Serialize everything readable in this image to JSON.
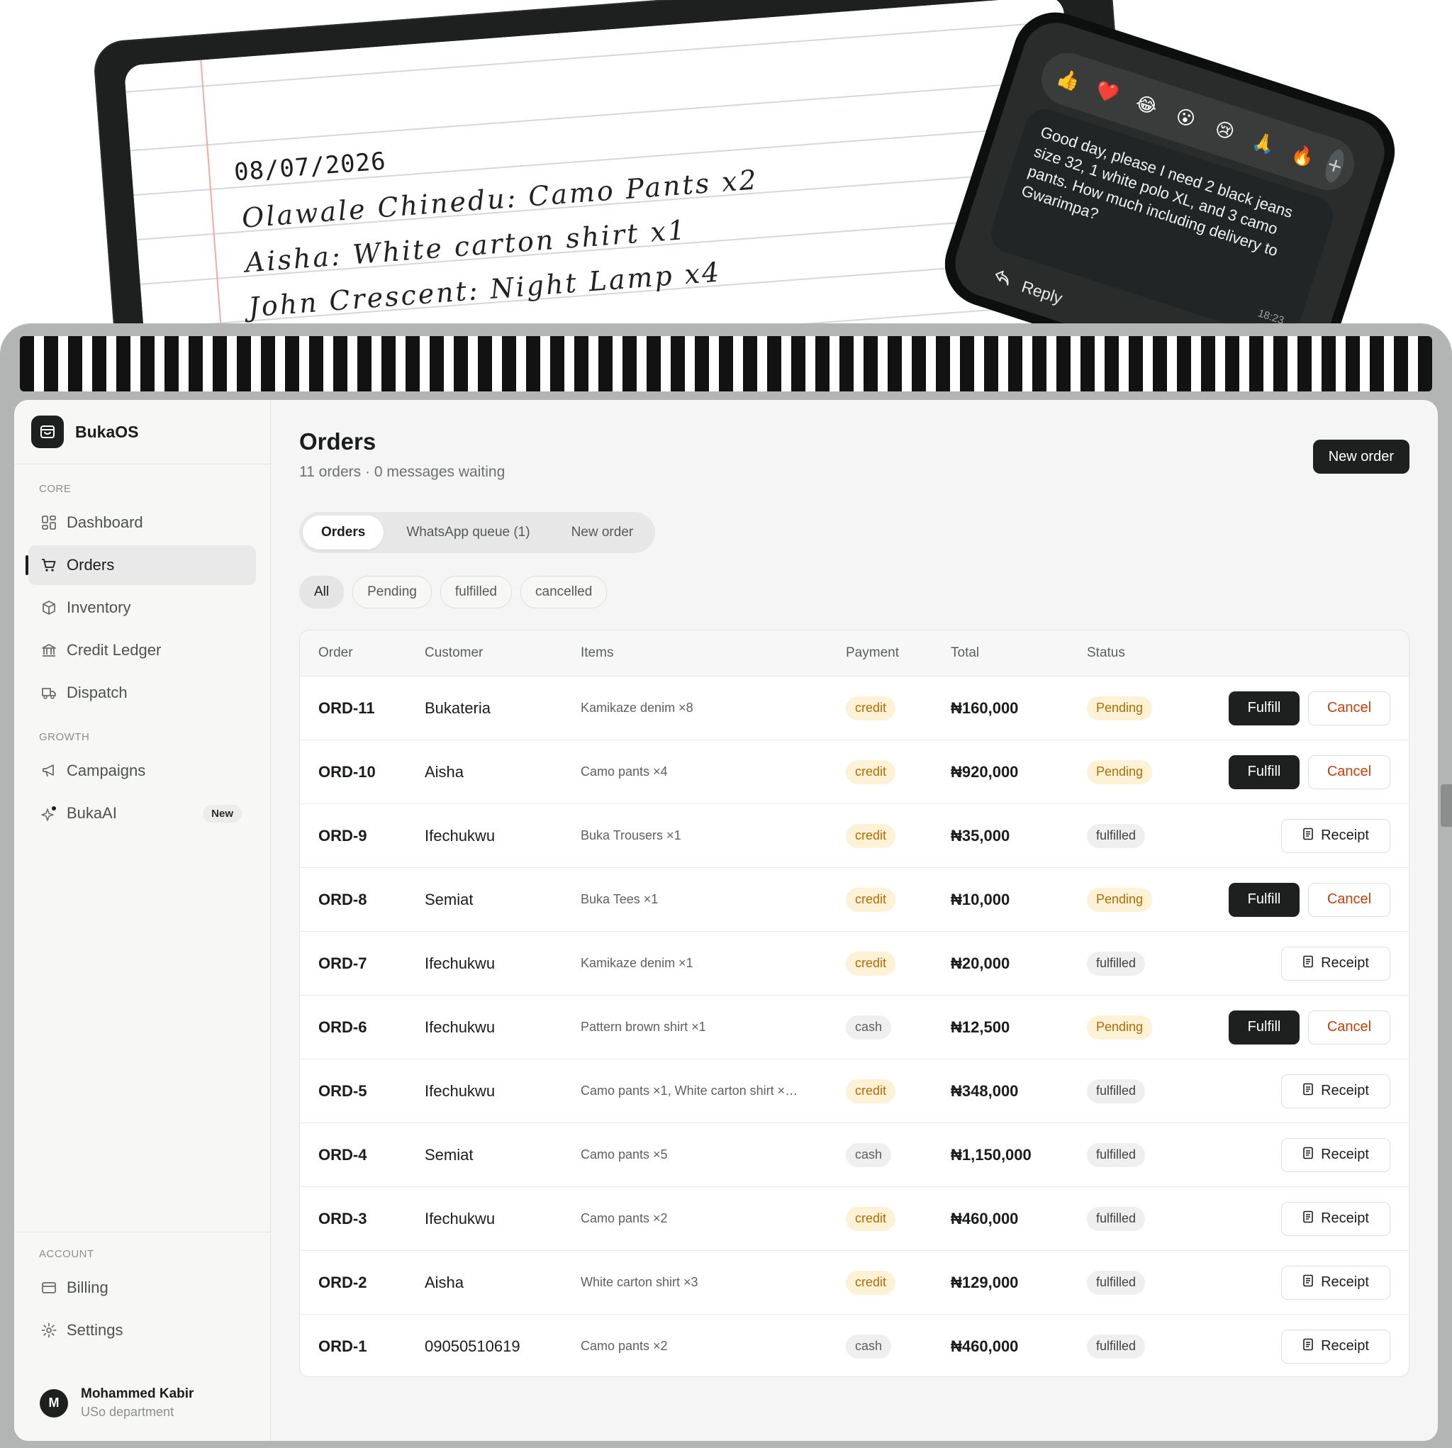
{
  "notepad": {
    "date": "08/07/2026",
    "lines": [
      "Olawale Chinedu: Camo Pants x2",
      "Aisha: White carton shirt x1",
      "John Crescent: Night Lamp x4"
    ]
  },
  "whatsapp": {
    "reactions": [
      "👍",
      "❤️",
      "😂",
      "😮",
      "😢",
      "🙏",
      "🔥"
    ],
    "plus": "+",
    "message": "Good day, please I need 2 black jeans size 32, 1 white polo XL, and 3 camo pants. How much including delivery to Gwarimpa?",
    "time": "18:23",
    "reply_label": "Reply"
  },
  "brand": {
    "name": "BukaOS"
  },
  "sidebar": {
    "core_heading": "CORE",
    "core_items": [
      {
        "label": "Dashboard",
        "icon": "dashboard-icon"
      },
      {
        "label": "Orders",
        "icon": "cart-icon",
        "active": true
      },
      {
        "label": "Inventory",
        "icon": "box-icon"
      },
      {
        "label": "Credit Ledger",
        "icon": "bank-icon"
      },
      {
        "label": "Dispatch",
        "icon": "truck-icon"
      }
    ],
    "growth_heading": "GROWTH",
    "growth_items": [
      {
        "label": "Campaigns",
        "icon": "megaphone-icon"
      },
      {
        "label": "BukaAI",
        "icon": "sparkle-icon",
        "badge": "New"
      }
    ],
    "account_heading": "ACCOUNT",
    "account_items": [
      {
        "label": "Billing",
        "icon": "card-icon"
      },
      {
        "label": "Settings",
        "icon": "gear-icon"
      }
    ],
    "user": {
      "initial": "M",
      "name": "Mohammed Kabir",
      "dept": "USo department"
    }
  },
  "header": {
    "title": "Orders",
    "subtitle": "11 orders · 0 messages waiting",
    "new_order_button": "New order"
  },
  "tabs": [
    "Orders",
    "WhatsApp queue (1)",
    "New order"
  ],
  "filters": [
    "All",
    "Pending",
    "fulfilled",
    "cancelled"
  ],
  "table": {
    "columns": [
      "Order",
      "Customer",
      "Items",
      "Payment",
      "Total",
      "Status"
    ],
    "rows": [
      {
        "order": "ORD-11",
        "customer": "Bukateria",
        "items": "Kamikaze denim ×8",
        "payment": "credit",
        "total": "₦160,000",
        "status": "Pending"
      },
      {
        "order": "ORD-10",
        "customer": "Aisha",
        "items": "Camo pants ×4",
        "payment": "credit",
        "total": "₦920,000",
        "status": "Pending"
      },
      {
        "order": "ORD-9",
        "customer": "Ifechukwu",
        "items": "Buka Trousers ×1",
        "payment": "credit",
        "total": "₦35,000",
        "status": "fulfilled"
      },
      {
        "order": "ORD-8",
        "customer": "Semiat",
        "items": "Buka Tees ×1",
        "payment": "credit",
        "total": "₦10,000",
        "status": "Pending"
      },
      {
        "order": "ORD-7",
        "customer": "Ifechukwu",
        "items": "Kamikaze denim ×1",
        "payment": "credit",
        "total": "₦20,000",
        "status": "fulfilled"
      },
      {
        "order": "ORD-6",
        "customer": "Ifechukwu",
        "items": "Pattern brown shirt ×1",
        "payment": "cash",
        "total": "₦12,500",
        "status": "Pending"
      },
      {
        "order": "ORD-5",
        "customer": "Ifechukwu",
        "items": "Camo pants ×1, White carton shirt ×…",
        "payment": "credit",
        "total": "₦348,000",
        "status": "fulfilled"
      },
      {
        "order": "ORD-4",
        "customer": "Semiat",
        "items": "Camo pants ×5",
        "payment": "cash",
        "total": "₦1,150,000",
        "status": "fulfilled"
      },
      {
        "order": "ORD-3",
        "customer": "Ifechukwu",
        "items": "Camo pants ×2",
        "payment": "credit",
        "total": "₦460,000",
        "status": "fulfilled"
      },
      {
        "order": "ORD-2",
        "customer": "Aisha",
        "items": "White carton shirt ×3",
        "payment": "credit",
        "total": "₦129,000",
        "status": "fulfilled"
      },
      {
        "order": "ORD-1",
        "customer": "09050510619",
        "items": "Camo pants ×2",
        "payment": "cash",
        "total": "₦460,000",
        "status": "fulfilled"
      }
    ],
    "actions": {
      "fulfill": "Fulfill",
      "cancel": "Cancel",
      "receipt": "Receipt"
    }
  },
  "colors": {
    "accent_dark": "#1e2020",
    "pending_bg": "#fdf1d6",
    "pending_text": "#b06d05",
    "cancel_text": "#c2410c"
  }
}
